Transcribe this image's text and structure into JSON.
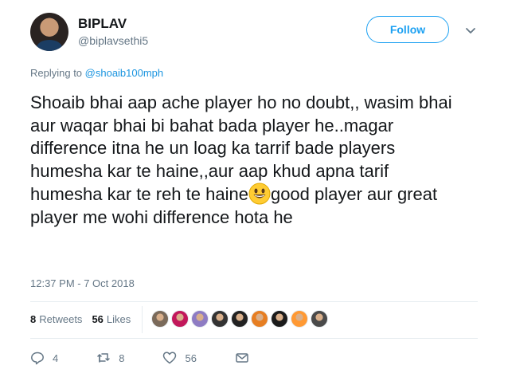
{
  "author": {
    "display_name": "BIPLAV",
    "screen_name": "@biplavsethi5"
  },
  "follow_button_label": "Follow",
  "reply_context": {
    "prefix": "Replying to ",
    "handle": "@shoaib100mph"
  },
  "tweet": {
    "text_part1": "Shoaib bhai aap ache player ho no doubt,, wasim bhai aur waqar bhai bi bahat bada player he..magar difference itna he un loag ka tarrif bade players humesha kar te haine,,aur aap khud apna tarif humesha kar te reh te haine",
    "emoji": "grinning-face-emoji",
    "text_part2": "good player aur great player me wohi difference hota he",
    "timestamp": "12:37 PM - 7 Oct 2018"
  },
  "stats": {
    "retweets_count": "8",
    "retweets_label": "Retweets",
    "likes_count": "56",
    "likes_label": "Likes"
  },
  "liker_avatars": [
    {
      "color": "#7a6a5a"
    },
    {
      "color": "#c2185b"
    },
    {
      "color": "#8e7cc3"
    },
    {
      "color": "#333333"
    },
    {
      "color": "#222222"
    },
    {
      "color": "#e67e22"
    },
    {
      "color": "#1b1b1b"
    },
    {
      "color": "#ff9933"
    },
    {
      "color": "#4a4a4a"
    }
  ],
  "actions": {
    "reply_count": "4",
    "retweet_count": "8",
    "like_count": "56"
  },
  "colors": {
    "accent": "#1da1f2",
    "muted": "#657786",
    "text": "#14171a"
  }
}
